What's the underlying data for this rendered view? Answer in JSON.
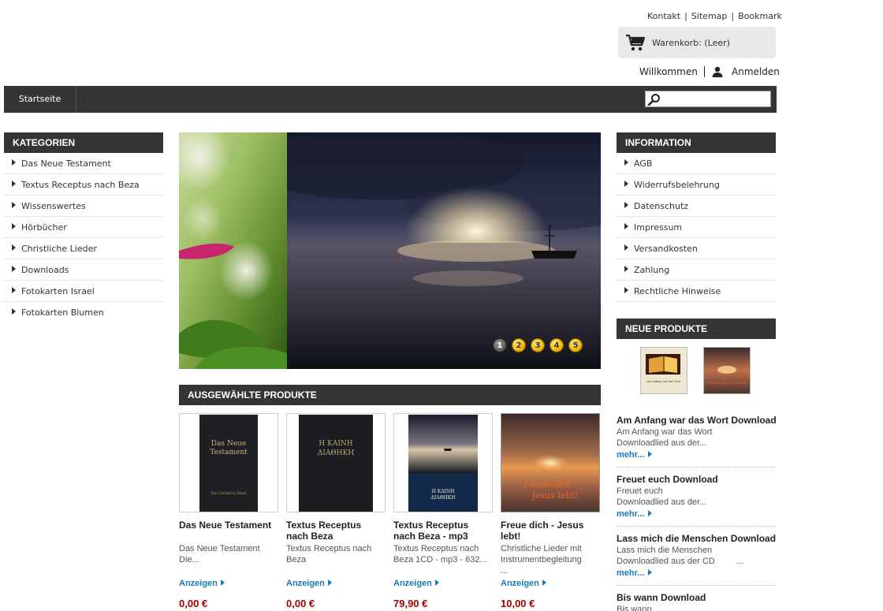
{
  "header": {
    "links": [
      "Kontakt",
      "Sitemap",
      "Bookmark"
    ],
    "cart": "Warenkorb: (Leer)",
    "welcome": "Willkommen",
    "login": "Anmelden"
  },
  "nav": {
    "home": "Startseite",
    "search_placeholder": ""
  },
  "categories": {
    "title": "KATEGORIEN",
    "items": [
      "Das Neue Testament",
      "Textus Receptus nach Beza",
      "Wissenswertes",
      "Hörbücher",
      "Christliche Lieder",
      "Downloads",
      "Fotokarten Israel",
      "Fotokarten Blumen"
    ]
  },
  "slider": {
    "pages": [
      "1",
      "2",
      "3",
      "4",
      "5"
    ],
    "active": "1"
  },
  "featured": {
    "title": "AUSGEWÄHLTE PRODUKTE",
    "more_label": "Anzeigen",
    "products": [
      {
        "title": "Das Neue Testament",
        "desc": "Das Neue Testament\n                    Die...",
        "price": "0,00 €",
        "cover_text_1": "Das Neue",
        "cover_text_2": "Testament",
        "cover_text_3": "Die Christlich Bibel"
      },
      {
        "title": "Textus Receptus nach Beza",
        "desc": "Textus Receptus nach Beza",
        "price": "0,00 €",
        "cover_text_1": "Η ΚΑΙΝΗ",
        "cover_text_2": "ΔΙΑΘΗΚΗ"
      },
      {
        "title": "Textus Receptus nach Beza - mp3",
        "desc": "Textus Receptus nach Beza              1CD - mp3 - 632...",
        "price": "79,90 €",
        "cover_text_1": "Η ΚΑΙΝΗ",
        "cover_text_2": "ΔΙΑΘΗΚΗ"
      },
      {
        "title": "Freue dich - Jesus lebt!",
        "desc": "Christliche Lieder mit Instrumentbegleitung\n        ...",
        "price": "10,00 €",
        "cover_text_1": "Freue dich -",
        "cover_text_2": "Jesus lebt!"
      }
    ]
  },
  "information": {
    "title": "INFORMATION",
    "items": [
      "AGB",
      "Widerrufsbelehrung",
      "Datenschutz",
      "Impressum",
      "Versandkosten",
      "Zahlung",
      "Rechtliche Hinweise"
    ]
  },
  "new_products": {
    "title": "NEUE PRODUKTE",
    "thumb1_text": "Am Anfang war das Wort",
    "thumb2_text": "Freuet euch Jesus lebt",
    "more_label": "mehr...",
    "items": [
      {
        "title": "Am Anfang war das Wort Download",
        "sub": "Am Anfang war das Wort",
        "desc": "Downloadlied aus der..."
      },
      {
        "title": "Freuet euch Download",
        "sub": "Freuet euch",
        "desc": "Downloadlied aus der..."
      },
      {
        "title": "Lass mich die Menschen Download",
        "sub": "Lass mich die Menschen",
        "desc": "Downloadlied aus der CD         ..."
      },
      {
        "title": "Bis wann Download",
        "sub": "Bis wann",
        "desc": ""
      }
    ]
  }
}
